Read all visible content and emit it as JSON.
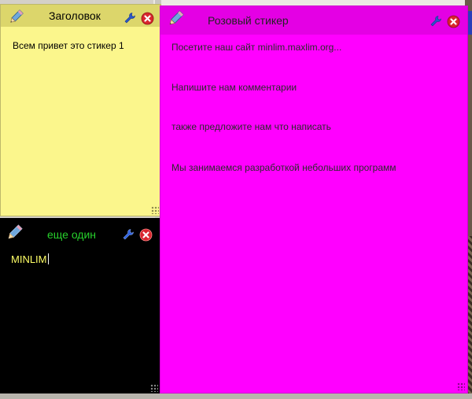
{
  "stickers": {
    "yellow": {
      "title": "Заголовок",
      "text": "Всем привет это стикер 1",
      "color": "#fbf68c"
    },
    "black": {
      "title": "еще один",
      "text": "MINLIM",
      "title_color": "#27d02c",
      "text_color": "#ffff66"
    },
    "magenta": {
      "title": "Розовый стикер",
      "color": "#ff00ff",
      "lines": [
        "Посетите наш сайт minlim.maxlim.org...",
        "Напишите нам комментарии",
        "также предложите нам что написать",
        "Мы занимаемся разработкой небольших программ"
      ]
    }
  },
  "icons": {
    "edit": "pencil-icon",
    "settings": "wrench-icon",
    "close": "close-icon",
    "resize": "resize-grip-icon"
  }
}
